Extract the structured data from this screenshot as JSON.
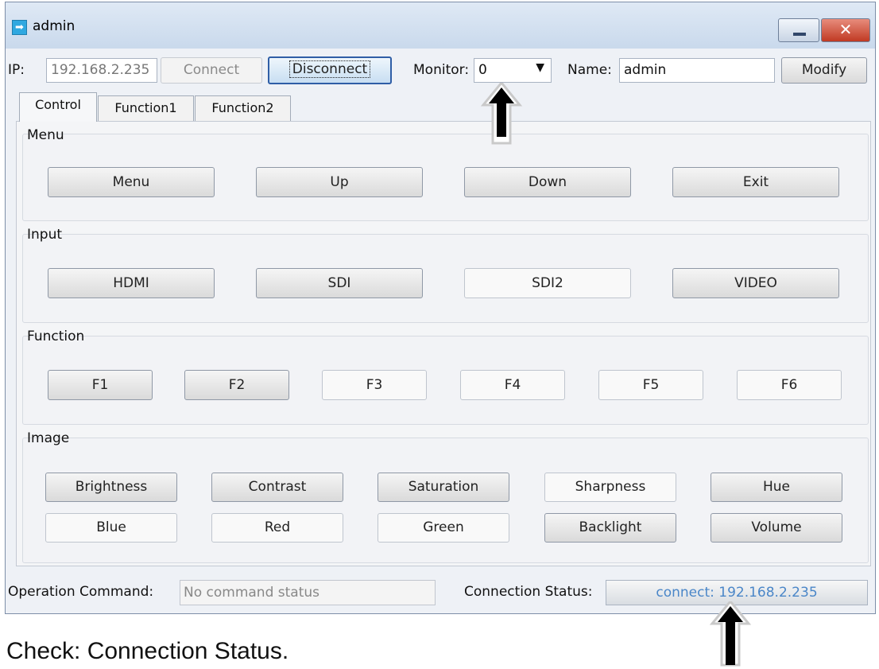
{
  "window": {
    "title": "admin",
    "icon": "arrow-right-icon",
    "min_icon": "minimize-icon",
    "close_icon": "close-icon",
    "close_glyph": "✕"
  },
  "toolbar": {
    "ip_label": "IP:",
    "ip_value": "192.168.2.235",
    "connect_label": "Connect",
    "disconnect_label": "Disconnect",
    "monitor_label": "Monitor:",
    "monitor_value": "0",
    "name_label": "Name:",
    "name_value": "admin",
    "modify_label": "Modify"
  },
  "tabs": [
    {
      "label": "Control",
      "active": true
    },
    {
      "label": "Function1",
      "active": false
    },
    {
      "label": "Function2",
      "active": false
    }
  ],
  "groups": {
    "menu": {
      "title": "Menu",
      "buttons": [
        "Menu",
        "Up",
        "Down",
        "Exit"
      ]
    },
    "input": {
      "title": "Input",
      "buttons": [
        "HDMI",
        "SDI",
        "SDI2",
        "VIDEO"
      ]
    },
    "function": {
      "title": "Function",
      "buttons": [
        "F1",
        "F2",
        "F3",
        "F4",
        "F5",
        "F6"
      ]
    },
    "image": {
      "title": "Image",
      "row1": [
        "Brightness",
        "Contrast",
        "Saturation",
        "Sharpness",
        "Hue"
      ],
      "row2": [
        "Blue",
        "Red",
        "Green",
        "Backlight",
        "Volume"
      ]
    }
  },
  "status": {
    "command_label": "Operation Command:",
    "command_value": "No command status",
    "connection_label": "Connection Status:",
    "connection_value": "connect: 192.168.2.235",
    "connection_color": "#4a86c8"
  },
  "caption": "Check: Connection Status."
}
